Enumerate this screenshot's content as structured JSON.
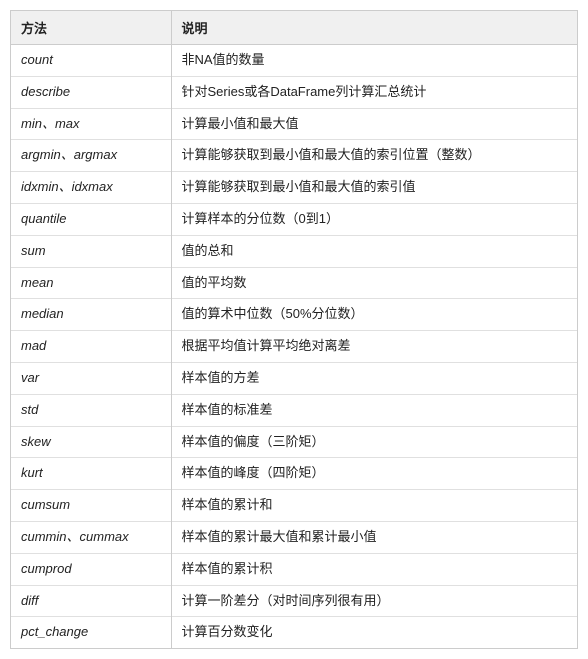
{
  "table": {
    "headers": [
      "方法",
      "说明"
    ],
    "rows": [
      {
        "method": "count",
        "description": "非NA值的数量"
      },
      {
        "method": "describe",
        "description": "针对Series或各DataFrame列计算汇总统计"
      },
      {
        "method": "min、max",
        "description": "计算最小值和最大值"
      },
      {
        "method": "argmin、argmax",
        "description": "计算能够获取到最小值和最大值的索引位置（整数）"
      },
      {
        "method": "idxmin、idxmax",
        "description": "计算能够获取到最小值和最大值的索引值"
      },
      {
        "method": "quantile",
        "description": "计算样本的分位数（0到1）"
      },
      {
        "method": "sum",
        "description": "值的总和"
      },
      {
        "method": "mean",
        "description": "值的平均数"
      },
      {
        "method": "median",
        "description": "值的算术中位数（50%分位数）"
      },
      {
        "method": "mad",
        "description": "根据平均值计算平均绝对离差"
      },
      {
        "method": "var",
        "description": "样本值的方差"
      },
      {
        "method": "std",
        "description": "样本值的标准差"
      },
      {
        "method": "skew",
        "description": "样本值的偏度（三阶矩）"
      },
      {
        "method": "kurt",
        "description": "样本值的峰度（四阶矩）"
      },
      {
        "method": "cumsum",
        "description": "样本值的累计和"
      },
      {
        "method": "cummin、cummax",
        "description": "样本值的累计最大值和累计最小值"
      },
      {
        "method": "cumprod",
        "description": "样本值的累计积"
      },
      {
        "method": "diff",
        "description": "计算一阶差分（对时间序列很有用）"
      },
      {
        "method": "pct_change",
        "description": "计算百分数变化"
      }
    ]
  }
}
